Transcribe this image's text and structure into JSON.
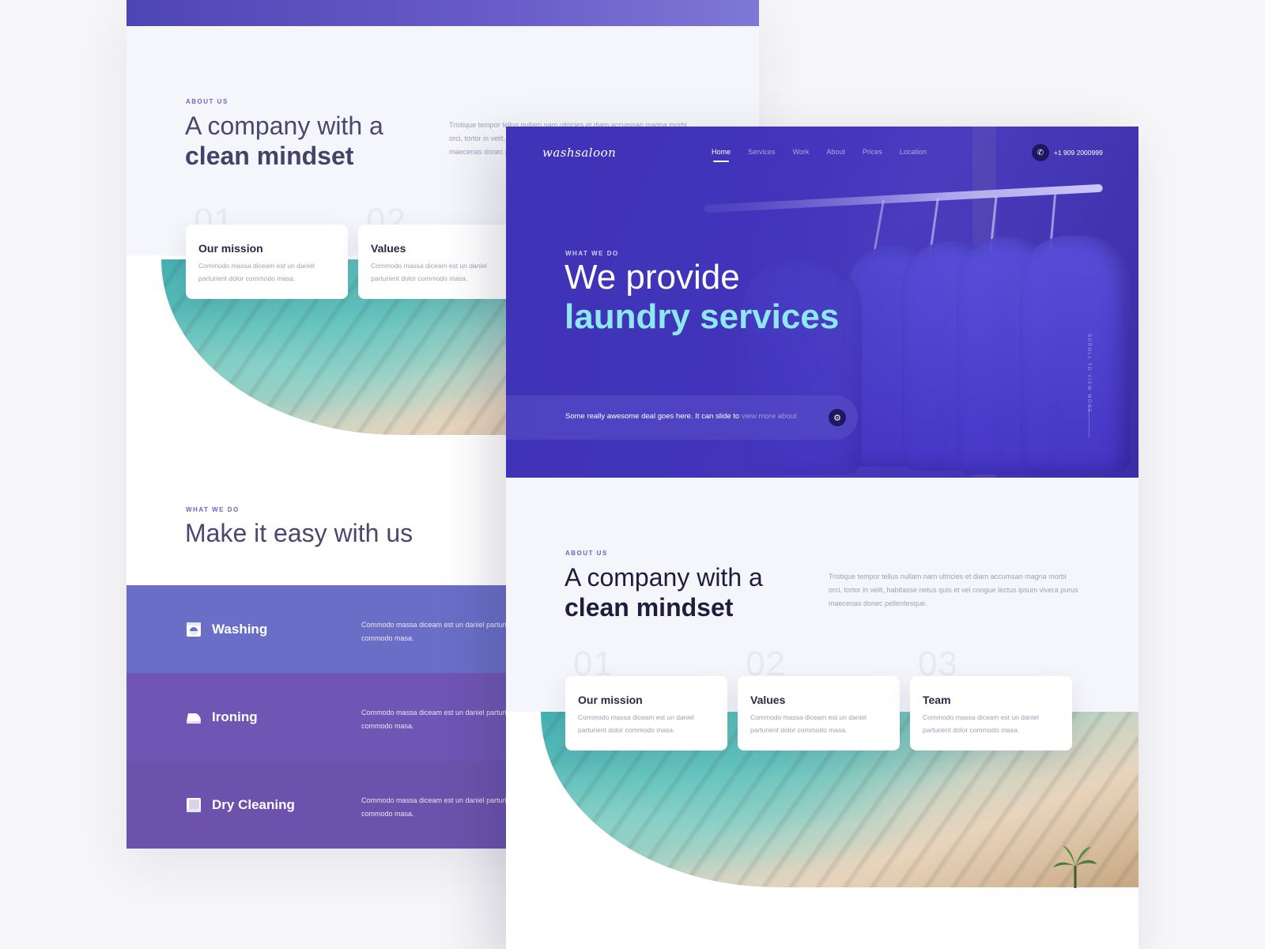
{
  "back_page": {
    "about": {
      "eyebrow": "ABOUT US",
      "heading_light": "A company with a",
      "heading_bold": "clean mindset",
      "paragraph": "Tristique tempor tellus nullam nam ultricies et diam accumsan magna morbi orci, tortor in velit, habitasse netus quis et vel congue lectus ipsum vivera purus maecenas donec pellentesque."
    },
    "cards": [
      {
        "num": "01",
        "title": "Our mission",
        "desc": "Commodo massa diceam est un daniel parturient dolor commodo masa."
      },
      {
        "num": "02",
        "title": "Values",
        "desc": "Commodo massa diceam est un daniel parturient dolor commodo masa."
      }
    ],
    "what_we_do": {
      "eyebrow": "WHAT WE DO",
      "heading": "Make it easy with us"
    },
    "services": [
      {
        "name": "Washing",
        "desc": "Commodo massa diceam est un daniel parturient dolor commodo masa."
      },
      {
        "name": "Ironing",
        "desc": "Commodo massa diceam est un daniel parturient dolor commodo masa."
      },
      {
        "name": "Dry Cleaning",
        "desc": "Commodo massa diceam est un daniel parturient dolor commodo masa."
      }
    ]
  },
  "front_page": {
    "logo": "washsaloon",
    "nav": [
      "Home",
      "Services",
      "Work",
      "About",
      "Prices",
      "Location"
    ],
    "nav_active": "Home",
    "phone": "+1 909 2000999",
    "hero": {
      "eyebrow": "WHAT WE DO",
      "line1": "We provide",
      "line2": "laundry services",
      "deal_text": "Some really awesome deal goes here. It can slide to ",
      "deal_fade": "view more about",
      "scroll_hint": "SCROLL TO VIEW MORE"
    },
    "about": {
      "eyebrow": "ABOUT US",
      "heading_light": "A company with a",
      "heading_bold": "clean mindset",
      "paragraph": "Tristique tempor tellus nullam nam ultricies et diam accumsan magna morbi orci, tortor in velit, habitasse netus quis et vel congue lectus ipsum vivera purus maecenas donec pellentesque."
    },
    "cards": [
      {
        "num": "01",
        "title": "Our mission",
        "desc": "Commodo massa diceam est un daniel parturient dolor commodo masa."
      },
      {
        "num": "02",
        "title": "Values",
        "desc": "Commodo massa diceam est un daniel parturient dolor commodo masa."
      },
      {
        "num": "03",
        "title": "Team",
        "desc": "Commodo massa diceam est un daniel parturient dolor commodo masa."
      }
    ]
  },
  "colors": {
    "hero_purple": "#3f33b8",
    "accent_cyan": "#8ee8f0",
    "eyebrow_purple": "#6b64c7",
    "washing_row": "#6a6ec6",
    "ironing_row": "#6f55b4",
    "dry_cleaning_row": "#6c52ac"
  },
  "icons": [
    "washing-machine-icon",
    "iron-icon",
    "dry-cleaning-icon",
    "phone-icon",
    "gear-icon"
  ]
}
